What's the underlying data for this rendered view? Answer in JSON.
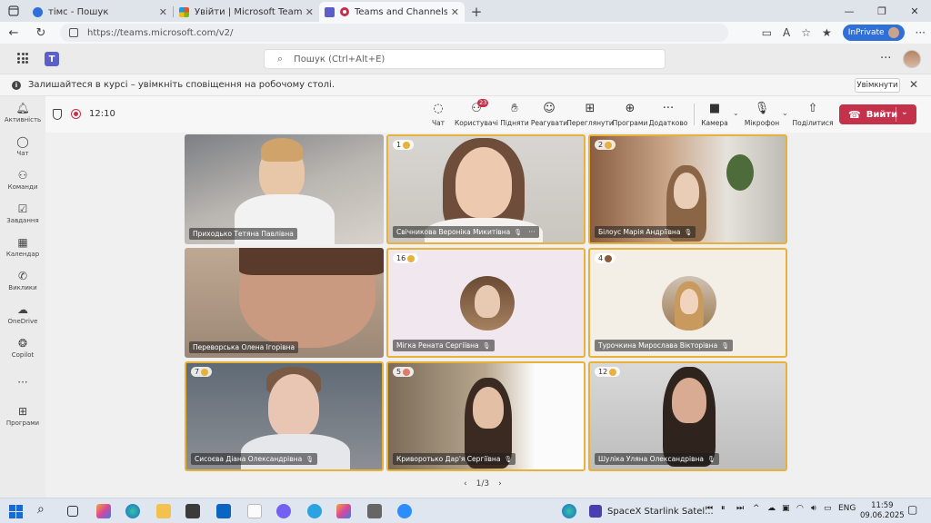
{
  "browser": {
    "tabs": [
      {
        "label": "тімс - Пошук",
        "icon_color": "#2f6fd8"
      },
      {
        "label": "Увійти | Microsoft Teams",
        "icon_color": "#e74c3c"
      },
      {
        "label": "Teams and Channels | Захис",
        "icon_color": "#5b5fc7",
        "active": true
      }
    ],
    "url": "https://teams.microsoft.com/v2/",
    "inprivate_label": "InPrivate"
  },
  "teams": {
    "search_placeholder": "Пошук (Ctrl+Alt+E)",
    "logo_letter": "T",
    "notification": {
      "text": "Залишайтеся в курсі – увімкніть сповіщення на робочому столі.",
      "button": "Увімкнути"
    },
    "rail": [
      {
        "label": "Активність",
        "icon": "bell-icon"
      },
      {
        "label": "Чат",
        "icon": "chat-icon"
      },
      {
        "label": "Команди",
        "icon": "teams-icon"
      },
      {
        "label": "Завдання",
        "icon": "tasks-icon"
      },
      {
        "label": "Календар",
        "icon": "calendar-icon"
      },
      {
        "label": "Виклики",
        "icon": "phone-icon"
      },
      {
        "label": "OneDrive",
        "icon": "cloud-icon"
      },
      {
        "label": "Copilot",
        "icon": "copilot-icon"
      },
      {
        "label": "",
        "icon": "more-icon"
      },
      {
        "label": "Програми",
        "icon": "add-apps-icon"
      }
    ]
  },
  "meeting": {
    "timer": "12:10",
    "toolbar": [
      {
        "label": "Чат",
        "icon": "chat-icon"
      },
      {
        "label": "Користувачі",
        "icon": "people-icon",
        "badge": "23"
      },
      {
        "label": "Підняти",
        "icon": "raise-hand-icon"
      },
      {
        "label": "Реагувати",
        "icon": "emoji-icon"
      },
      {
        "label": "Переглянути",
        "icon": "view-icon"
      },
      {
        "label": "Програми",
        "icon": "apps-icon"
      },
      {
        "label": "Додатково",
        "icon": "more-icon"
      },
      {
        "label": "Камера",
        "icon": "camera-icon"
      },
      {
        "label": "Мікрофон",
        "icon": "mic-icon"
      },
      {
        "label": "Поділитися",
        "icon": "share-icon"
      }
    ],
    "leave_label": "Вийти",
    "participants": [
      {
        "name": "Приходько Тетяна Павлівна",
        "hand": "",
        "mic": false,
        "highlight": false
      },
      {
        "name": "Свічникова Вероніка Микитівна",
        "hand": "1",
        "mic": true,
        "more": true,
        "highlight": true
      },
      {
        "name": "Білоус Марія Андріївна",
        "hand": "2",
        "mic": true,
        "highlight": true
      },
      {
        "name": "Переворська Олена Ігорівна",
        "hand": "",
        "mic": false,
        "highlight": false
      },
      {
        "name": "Мігка Рената Сергіївна",
        "hand": "16",
        "mic": true,
        "highlight": true
      },
      {
        "name": "Турочкина Мирослава Вікторівна",
        "hand": "4",
        "mic": true,
        "highlight": true
      },
      {
        "name": "Сисоєва Діана Олександрівна",
        "hand": "7",
        "mic": true,
        "highlight": true
      },
      {
        "name": "Криворотько Дар'я Сергіївна",
        "hand": "5",
        "mic": true,
        "highlight": true
      },
      {
        "name": "Шуліка Уляна Олександрівна",
        "hand": "12",
        "mic": true,
        "highlight": true
      }
    ],
    "pager": "1/3"
  },
  "taskbar": {
    "window_title": "SpaceX Starlink Satel...",
    "language": "ENG",
    "time": "11:59",
    "date": "09.06.2025"
  }
}
